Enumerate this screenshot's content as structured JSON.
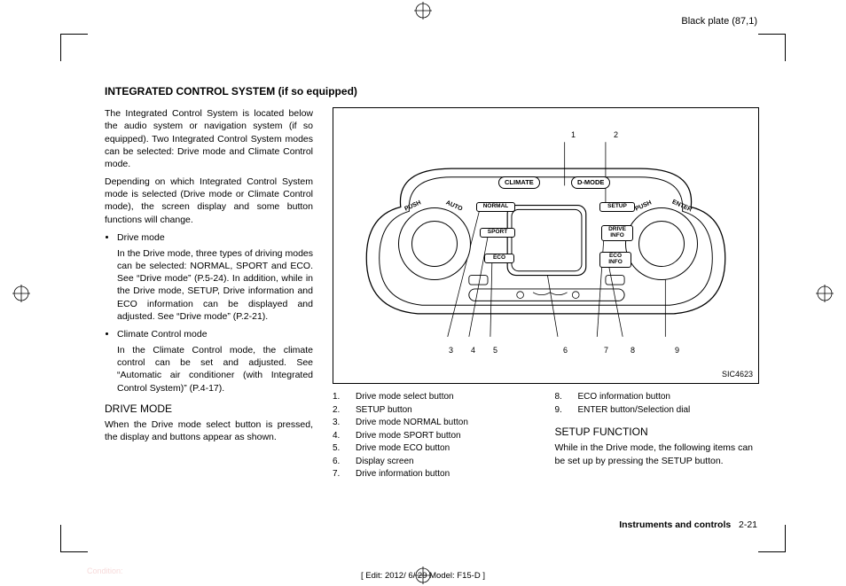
{
  "plate_label": "Black plate (87,1)",
  "heading": "INTEGRATED CONTROL SYSTEM (if so equipped)",
  "p1": "The Integrated Control System is located below the audio system or navigation system (if so equipped). Two Integrated Control System modes can be selected: Drive mode and Climate Control mode.",
  "p2": "Depending on which Integrated Control System mode is selected (Drive mode or Climate Control mode), the screen display and some button functions will change.",
  "b1_title": "Drive mode",
  "b1_body": "In the Drive mode, three types of driving modes can be selected: NORMAL, SPORT and ECO. See “Drive mode” (P.5-24). In addition, while in the Drive mode, SETUP, Drive information and ECO information can be displayed and adjusted. See “Drive mode” (P.2-21).",
  "b2_title": "Climate Control mode",
  "b2_body": "In the Climate Control mode, the climate control can be set and adjusted. See “Automatic air conditioner (with Integrated Control System)” (P.4-17).",
  "drive_mode_head": "DRIVE MODE",
  "drive_mode_body": "When the Drive mode select button is pressed, the display and buttons appear as shown.",
  "diagram_code": "SIC4623",
  "labels": {
    "climate": "CLIMATE",
    "dmode": "D-MODE",
    "normal": "NORMAL",
    "setup": "SETUP",
    "sport": "SPORT",
    "driveinfo": "DRIVE\nINFO",
    "eco": "ECO",
    "ecoinfo": "ECO\nINFO",
    "push": "PUSH",
    "auto": "AUTO",
    "enter": "ENTER"
  },
  "callouts_top": [
    "1",
    "2"
  ],
  "callouts_bottom": [
    "3",
    "4",
    "5",
    "6",
    "7",
    "8",
    "9"
  ],
  "legend_left": [
    {
      "n": "1.",
      "t": "Drive mode select button"
    },
    {
      "n": "2.",
      "t": "SETUP button"
    },
    {
      "n": "3.",
      "t": "Drive mode NORMAL button"
    },
    {
      "n": "4.",
      "t": "Drive mode SPORT button"
    },
    {
      "n": "5.",
      "t": "Drive mode ECO button"
    },
    {
      "n": "6.",
      "t": "Display screen"
    },
    {
      "n": "7.",
      "t": "Drive information button"
    }
  ],
  "legend_right": [
    {
      "n": "8.",
      "t": "ECO information button"
    },
    {
      "n": "9.",
      "t": "ENTER button/Selection dial"
    }
  ],
  "setup_head": "SETUP FUNCTION",
  "setup_body": "While in the Drive mode, the following items can be set up by pressing the SETUP button.",
  "footer_section": "Instruments and controls",
  "footer_page": "2-21",
  "edit_line": "[ Edit: 2012/ 6/ 29   Model: F15-D ]",
  "condition": "Condition:"
}
